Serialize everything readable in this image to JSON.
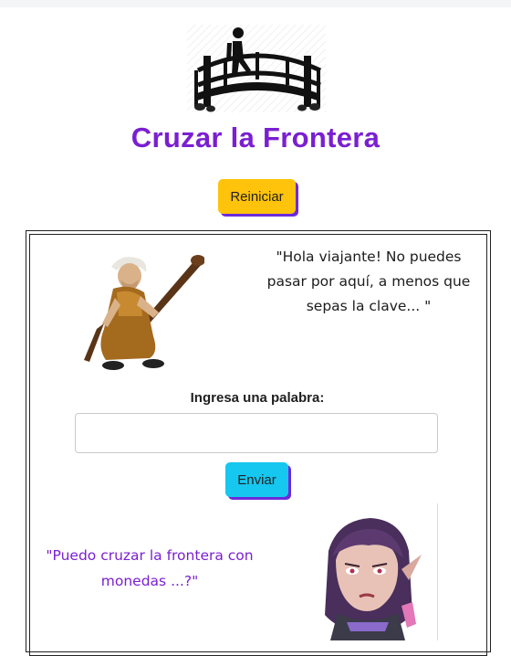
{
  "page": {
    "title": "Cruzar la Frontera"
  },
  "header": {
    "logo_icon": "bridge-walker-icon",
    "reset_label": "Reiniciar"
  },
  "game": {
    "villain_icon": "old-woman-with-club-icon",
    "villain_speech": "\"Hola viajante! No puedes pasar por aquí, a menos que sepas la clave... \"",
    "input_label": "Ingresa una palabra:",
    "input_value": "",
    "input_placeholder": "",
    "send_label": "Enviar",
    "player_speech": "\"Puedo cruzar la frontera con monedas ...?\"",
    "player_icon": "elf-girl-icon"
  },
  "colors": {
    "accent_purple": "#7a1fd1",
    "reset_button": "#ffc30b",
    "send_button": "#16c7f0",
    "button_shadow": "#6c2bd9"
  }
}
